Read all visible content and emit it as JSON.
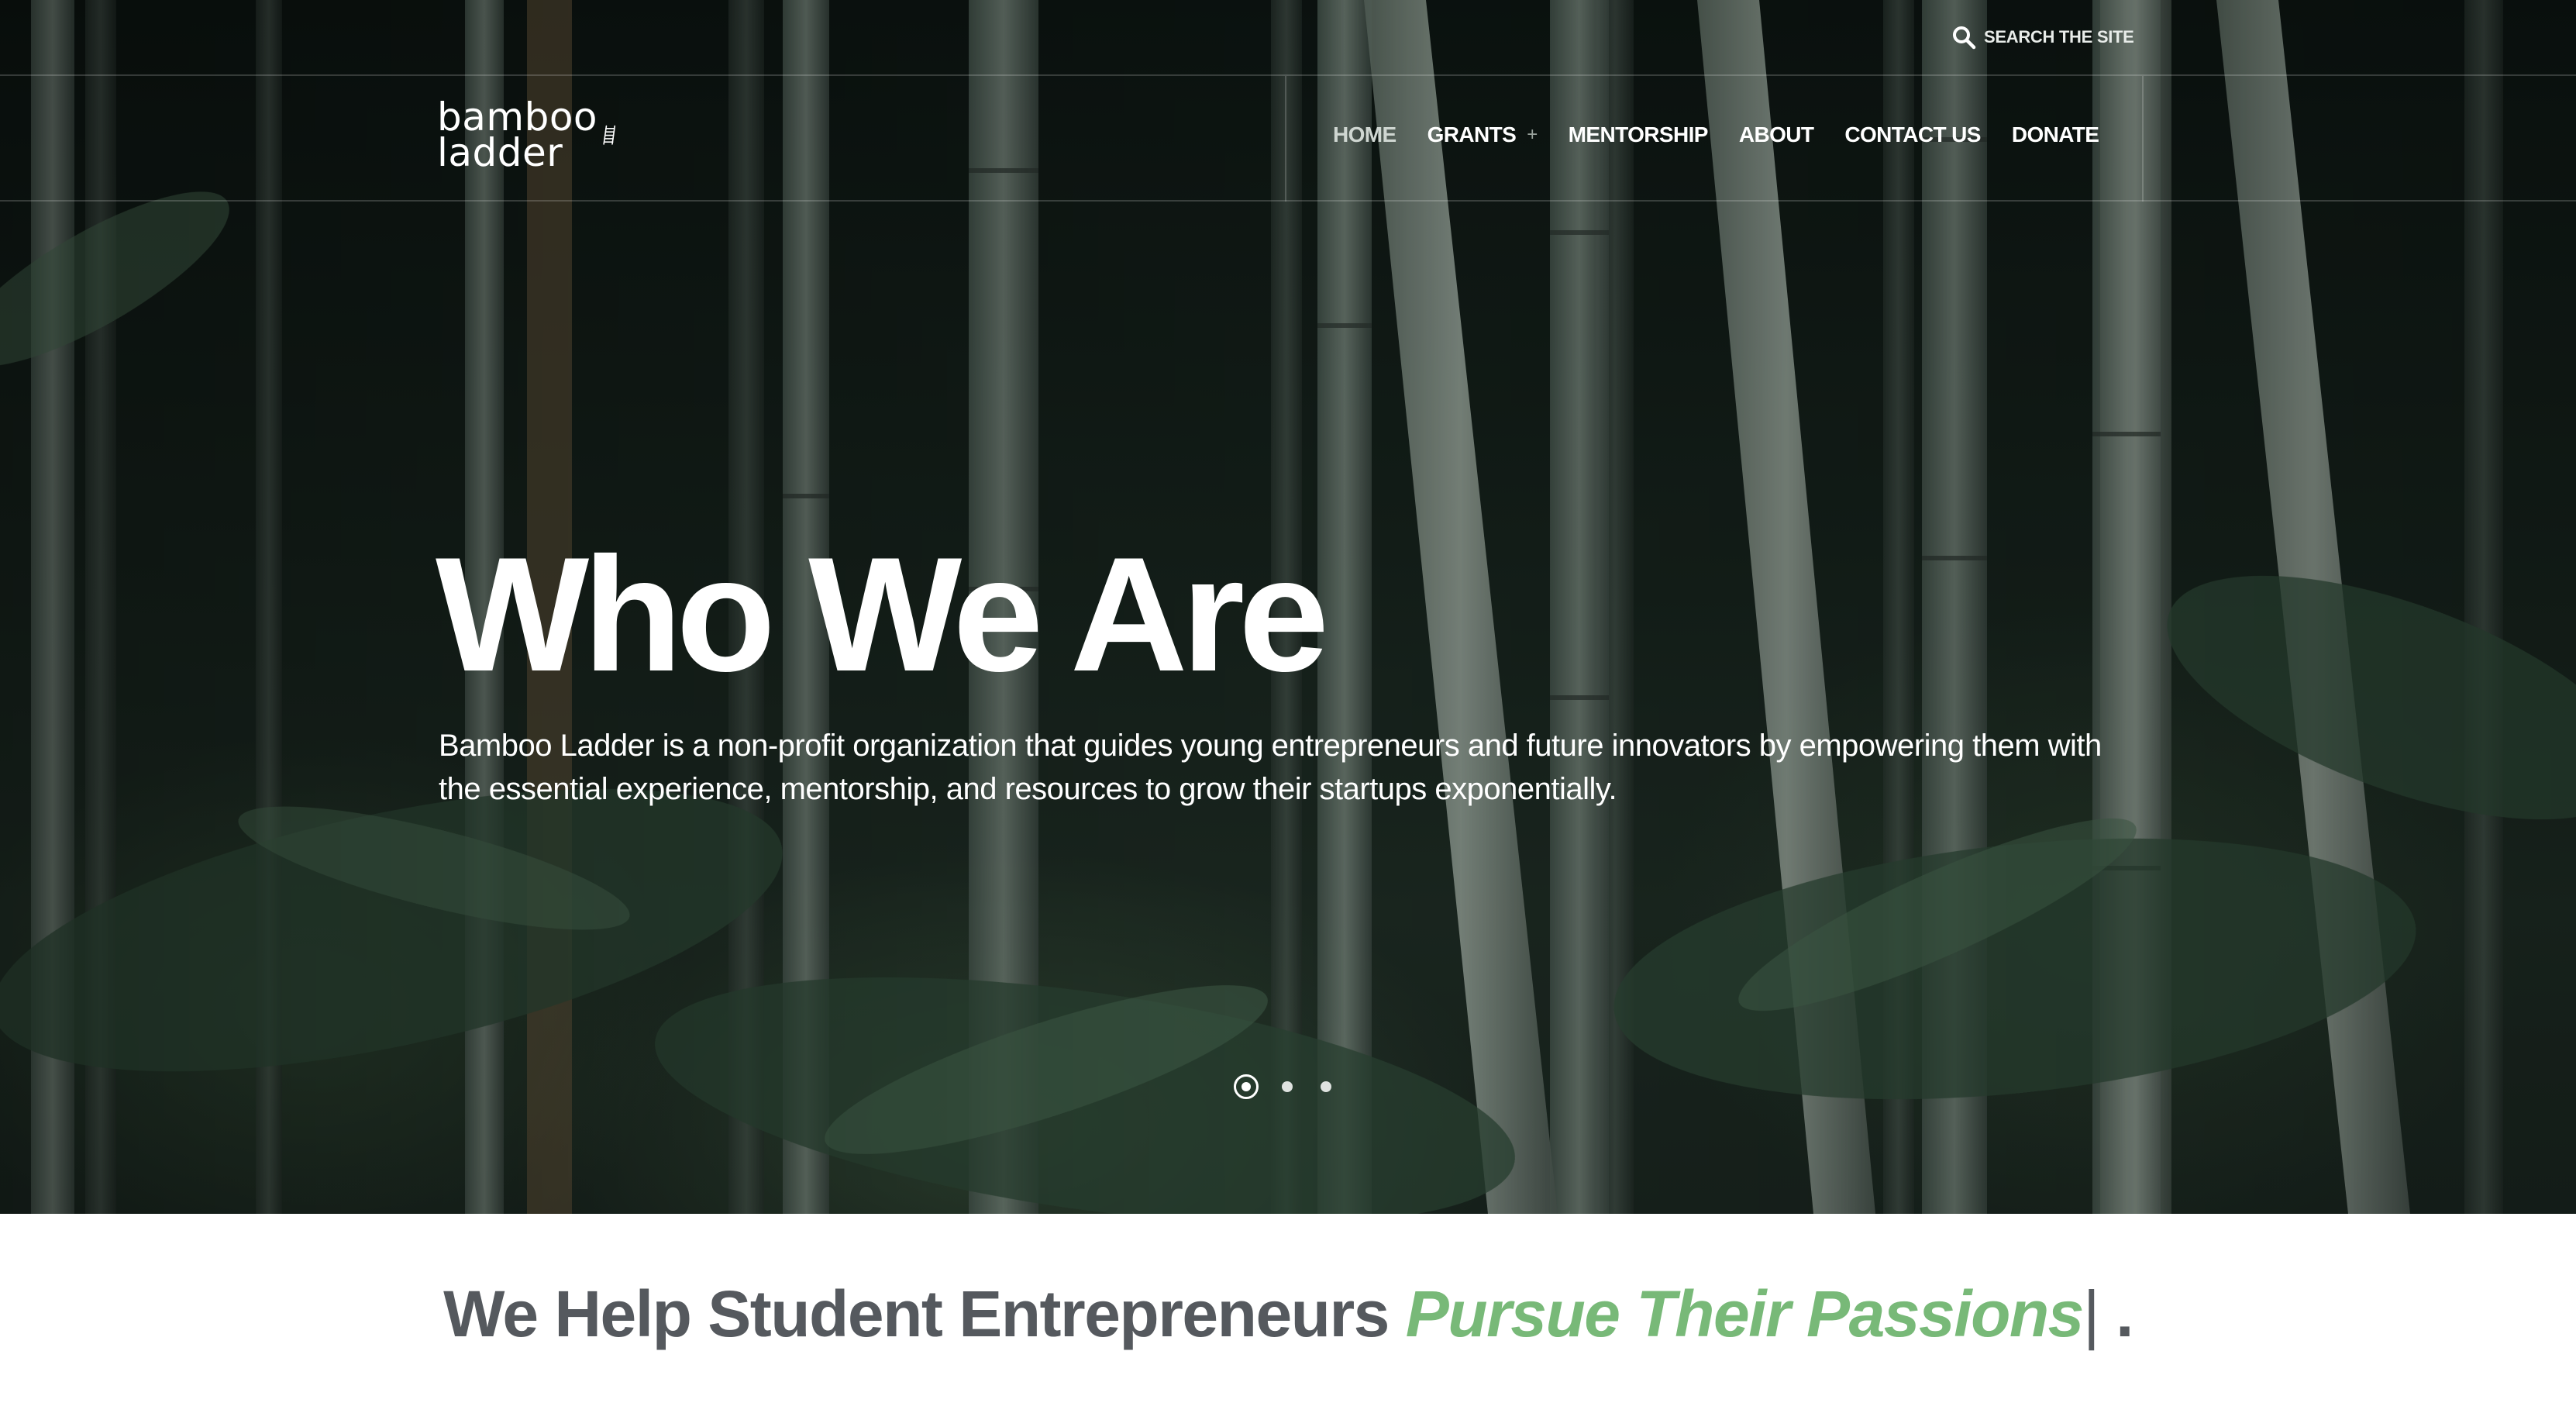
{
  "header": {
    "search_label": "SEARCH THE SITE",
    "logo": {
      "line1": "bamboo",
      "line2": "ladder"
    },
    "nav": [
      {
        "label": "HOME",
        "active": true,
        "has_submenu": false
      },
      {
        "label": "GRANTS",
        "active": false,
        "has_submenu": true
      },
      {
        "label": "MENTORSHIP",
        "active": false,
        "has_submenu": false
      },
      {
        "label": "ABOUT",
        "active": false,
        "has_submenu": false
      },
      {
        "label": "CONTACT US",
        "active": false,
        "has_submenu": false
      },
      {
        "label": "DONATE",
        "active": false,
        "has_submenu": false
      }
    ],
    "submenu_symbol": "+"
  },
  "hero": {
    "title": "Who We Are",
    "description": "Bamboo Ladder is a non-profit organization that guides young entrepreneurs and future innovators by empowering them with the essential experience, mentorship, and resources to grow their startups exponentially.",
    "slides_total": 3,
    "active_slide": 1
  },
  "tagline": {
    "static": "We Help Student Entrepreneurs ",
    "highlight": "Pursue Their Passions",
    "cursor": "|",
    "ending": " ."
  },
  "colors": {
    "highlight_green": "#78b978",
    "tagline_gray": "#55595e",
    "hero_bg": "#16221c"
  },
  "icons": {
    "search": "search-icon",
    "logo_mark": "ladder-icon",
    "submenu": "plus-icon"
  }
}
